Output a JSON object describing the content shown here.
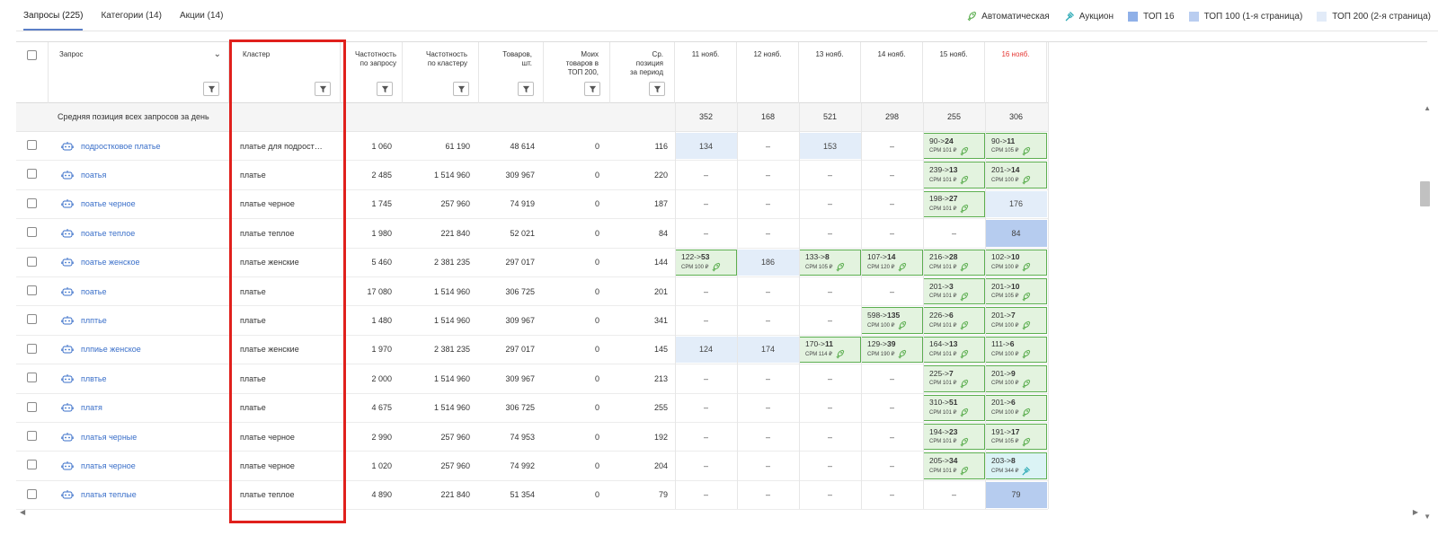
{
  "tabs": [
    {
      "label": "Запросы (225)",
      "active": true
    },
    {
      "label": "Категории (14)",
      "active": false
    },
    {
      "label": "Акции (14)",
      "active": false
    }
  ],
  "legend": {
    "auto_label": "Автоматическая",
    "auction_label": "Аукцион",
    "top16_label": "ТОП 16",
    "top100_label": "ТОП 100 (1-я страница)",
    "top200_label": "ТОП 200 (2-я страница)",
    "colors": {
      "top16": "#8fb0e8",
      "top100": "#b9cdf0",
      "top200": "#e2ebf8",
      "auto": "#5cae50",
      "auction": "#2ba9b5"
    }
  },
  "headers": {
    "query": "Запрос",
    "cluster": "Кластер",
    "freq_query": [
      "Частотность",
      "по запросу"
    ],
    "freq_cluster": [
      "Частотность",
      "по кластеру"
    ],
    "goods": [
      "Товаров,",
      "шт."
    ],
    "mine": [
      "Моих",
      "товаров в",
      "ТОП 200,"
    ],
    "avgpos": [
      "Ср.",
      "позиция",
      "за период"
    ],
    "dates": [
      "11 нояб.",
      "12 нояб.",
      "13 нояб.",
      "14 нояб.",
      "15 нояб.",
      "16 нояб."
    ]
  },
  "avg_row": {
    "label": "Средняя позиция всех запросов за день",
    "values": [
      "352",
      "168",
      "521",
      "298",
      "255",
      "306"
    ]
  },
  "rows": [
    {
      "query": "подростковое платье",
      "cluster": "платье для подрост…",
      "fq": "1 060",
      "fc": "61 190",
      "goods": "48 614",
      "mine": "0",
      "avg": "116",
      "days": [
        {
          "t": "top100",
          "v": "134"
        },
        {
          "t": "none",
          "v": "–"
        },
        {
          "t": "top100",
          "v": "153"
        },
        {
          "t": "none",
          "v": "–"
        },
        {
          "t": "auto",
          "a": "90->",
          "b": "24",
          "cpm": "СРМ 101 ₽"
        },
        {
          "t": "auto",
          "a": "90->",
          "b": "11",
          "cpm": "СРМ 105 ₽"
        }
      ]
    },
    {
      "query": "поатья",
      "cluster": "платье",
      "fq": "2 485",
      "fc": "1 514 960",
      "goods": "309 967",
      "mine": "0",
      "avg": "220",
      "days": [
        {
          "t": "none",
          "v": "–"
        },
        {
          "t": "none",
          "v": "–"
        },
        {
          "t": "none",
          "v": "–"
        },
        {
          "t": "none",
          "v": "–"
        },
        {
          "t": "auto",
          "a": "239->",
          "b": "13",
          "cpm": "СРМ 101 ₽"
        },
        {
          "t": "auto",
          "a": "201->",
          "b": "14",
          "cpm": "СРМ 100 ₽"
        }
      ]
    },
    {
      "query": "поатье черное",
      "cluster": "платье черное",
      "fq": "1 745",
      "fc": "257 960",
      "goods": "74 919",
      "mine": "0",
      "avg": "187",
      "days": [
        {
          "t": "none",
          "v": "–"
        },
        {
          "t": "none",
          "v": "–"
        },
        {
          "t": "none",
          "v": "–"
        },
        {
          "t": "none",
          "v": "–"
        },
        {
          "t": "auto",
          "a": "198->",
          "b": "27",
          "cpm": "СРМ 101 ₽"
        },
        {
          "t": "top100",
          "v": "176"
        }
      ]
    },
    {
      "query": "поатье теплое",
      "cluster": "платье теплое",
      "fq": "1 980",
      "fc": "221 840",
      "goods": "52 021",
      "mine": "0",
      "avg": "84",
      "days": [
        {
          "t": "none",
          "v": "–"
        },
        {
          "t": "none",
          "v": "–"
        },
        {
          "t": "none",
          "v": "–"
        },
        {
          "t": "none",
          "v": "–"
        },
        {
          "t": "none",
          "v": "–"
        },
        {
          "t": "top16",
          "v": "84"
        }
      ]
    },
    {
      "query": "поатье женское",
      "cluster": "платье женские",
      "fq": "5 460",
      "fc": "2 381 235",
      "goods": "297 017",
      "mine": "0",
      "avg": "144",
      "days": [
        {
          "t": "auto",
          "a": "122->",
          "b": "53",
          "cpm": "СРМ 100 ₽"
        },
        {
          "t": "top100",
          "v": "186"
        },
        {
          "t": "auto",
          "a": "133->",
          "b": "8",
          "cpm": "СРМ 105 ₽"
        },
        {
          "t": "auto",
          "a": "107->",
          "b": "14",
          "cpm": "СРМ 120 ₽"
        },
        {
          "t": "auto",
          "a": "216->",
          "b": "28",
          "cpm": "СРМ 101 ₽"
        },
        {
          "t": "auto",
          "a": "102->",
          "b": "10",
          "cpm": "СРМ 100 ₽"
        }
      ]
    },
    {
      "query": "поатье",
      "cluster": "платье",
      "fq": "17 080",
      "fc": "1 514 960",
      "goods": "306 725",
      "mine": "0",
      "avg": "201",
      "days": [
        {
          "t": "none",
          "v": "–"
        },
        {
          "t": "none",
          "v": "–"
        },
        {
          "t": "none",
          "v": "–"
        },
        {
          "t": "none",
          "v": "–"
        },
        {
          "t": "auto",
          "a": "201->",
          "b": "3",
          "cpm": "СРМ 101 ₽"
        },
        {
          "t": "auto",
          "a": "201->",
          "b": "10",
          "cpm": "СРМ 105 ₽"
        }
      ]
    },
    {
      "query": "плптье",
      "cluster": "платье",
      "fq": "1 480",
      "fc": "1 514 960",
      "goods": "309 967",
      "mine": "0",
      "avg": "341",
      "days": [
        {
          "t": "none",
          "v": "–"
        },
        {
          "t": "none",
          "v": "–"
        },
        {
          "t": "none",
          "v": "–"
        },
        {
          "t": "auto",
          "a": "598->",
          "b": "135",
          "cpm": "СРМ 100 ₽"
        },
        {
          "t": "auto",
          "a": "226->",
          "b": "6",
          "cpm": "СРМ 101 ₽"
        },
        {
          "t": "auto",
          "a": "201->",
          "b": "7",
          "cpm": "СРМ 100 ₽"
        }
      ]
    },
    {
      "query": "плпиье женское",
      "cluster": "платье женские",
      "fq": "1 970",
      "fc": "2 381 235",
      "goods": "297 017",
      "mine": "0",
      "avg": "145",
      "days": [
        {
          "t": "top100",
          "v": "124"
        },
        {
          "t": "top100",
          "v": "174"
        },
        {
          "t": "auto",
          "a": "170->",
          "b": "11",
          "cpm": "СРМ 114 ₽"
        },
        {
          "t": "auto",
          "a": "129->",
          "b": "39",
          "cpm": "СРМ 190 ₽"
        },
        {
          "t": "auto",
          "a": "164->",
          "b": "13",
          "cpm": "СРМ 101 ₽"
        },
        {
          "t": "auto",
          "a": "111->",
          "b": "6",
          "cpm": "СРМ 100 ₽"
        }
      ]
    },
    {
      "query": "плвтье",
      "cluster": "платье",
      "fq": "2 000",
      "fc": "1 514 960",
      "goods": "309 967",
      "mine": "0",
      "avg": "213",
      "days": [
        {
          "t": "none",
          "v": "–"
        },
        {
          "t": "none",
          "v": "–"
        },
        {
          "t": "none",
          "v": "–"
        },
        {
          "t": "none",
          "v": "–"
        },
        {
          "t": "auto",
          "a": "225->",
          "b": "7",
          "cpm": "СРМ 101 ₽"
        },
        {
          "t": "auto",
          "a": "201->",
          "b": "9",
          "cpm": "СРМ 100 ₽"
        }
      ]
    },
    {
      "query": "платя",
      "cluster": "платье",
      "fq": "4 675",
      "fc": "1 514 960",
      "goods": "306 725",
      "mine": "0",
      "avg": "255",
      "days": [
        {
          "t": "none",
          "v": "–"
        },
        {
          "t": "none",
          "v": "–"
        },
        {
          "t": "none",
          "v": "–"
        },
        {
          "t": "none",
          "v": "–"
        },
        {
          "t": "auto",
          "a": "310->",
          "b": "51",
          "cpm": "СРМ 101 ₽"
        },
        {
          "t": "auto",
          "a": "201->",
          "b": "6",
          "cpm": "СРМ 100 ₽"
        }
      ]
    },
    {
      "query": "платья черные",
      "cluster": "платье черное",
      "fq": "2 990",
      "fc": "257 960",
      "goods": "74 953",
      "mine": "0",
      "avg": "192",
      "days": [
        {
          "t": "none",
          "v": "–"
        },
        {
          "t": "none",
          "v": "–"
        },
        {
          "t": "none",
          "v": "–"
        },
        {
          "t": "none",
          "v": "–"
        },
        {
          "t": "auto",
          "a": "194->",
          "b": "23",
          "cpm": "СРМ 101 ₽"
        },
        {
          "t": "auto",
          "a": "191->",
          "b": "17",
          "cpm": "СРМ 105 ₽"
        }
      ]
    },
    {
      "query": "платья черное",
      "cluster": "платье черное",
      "fq": "1 020",
      "fc": "257 960",
      "goods": "74 992",
      "mine": "0",
      "avg": "204",
      "days": [
        {
          "t": "none",
          "v": "–"
        },
        {
          "t": "none",
          "v": "–"
        },
        {
          "t": "none",
          "v": "–"
        },
        {
          "t": "none",
          "v": "–"
        },
        {
          "t": "auto",
          "a": "205->",
          "b": "34",
          "cpm": "СРМ 101 ₽"
        },
        {
          "t": "auc",
          "a": "203->",
          "b": "8",
          "cpm": "СРМ 344 ₽"
        }
      ]
    },
    {
      "query": "платья теплые",
      "cluster": "платье теплое",
      "fq": "4 890",
      "fc": "221 840",
      "goods": "51 354",
      "mine": "0",
      "avg": "79",
      "days": [
        {
          "t": "none",
          "v": "–"
        },
        {
          "t": "none",
          "v": "–"
        },
        {
          "t": "none",
          "v": "–"
        },
        {
          "t": "none",
          "v": "–"
        },
        {
          "t": "none",
          "v": "–"
        },
        {
          "t": "top16",
          "v": "79"
        }
      ]
    }
  ]
}
